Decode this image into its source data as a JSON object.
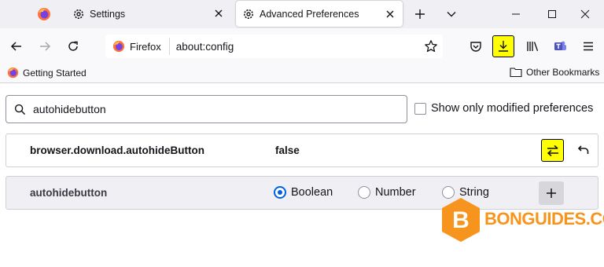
{
  "tabs": [
    {
      "name": "firefox-tab",
      "title": ""
    },
    {
      "name": "settings-tab",
      "title": "Settings"
    },
    {
      "name": "advanced-preferences-tab",
      "title": "Advanced Preferences",
      "active": true
    }
  ],
  "navbar": {
    "identity_label": "Firefox",
    "url": "about:config"
  },
  "bookmarks": {
    "left_item": "Getting Started",
    "right_item": "Other Bookmarks"
  },
  "config": {
    "search_value": "autohidebutton",
    "modified_only_label": "Show only modified preferences",
    "modified_only_checked": false,
    "existing_pref": {
      "name": "browser.download.autohideButton",
      "value": "false"
    },
    "new_pref": {
      "name": "autohidebutton",
      "types": [
        "Boolean",
        "Number",
        "String"
      ],
      "selected": "Boolean"
    }
  },
  "watermark": {
    "text": "BONGUIDES.COM",
    "letter": "B"
  },
  "colors": {
    "highlight": "#ffff00",
    "accent": "#0061e0",
    "watermark": "#f7941d",
    "firefox_orange": "#ff7139",
    "firefox_purple": "#7542e5"
  },
  "icons": [
    "firefox-logo-icon",
    "gear-icon",
    "close-icon",
    "plus-icon",
    "chevron-down-icon",
    "minimize-icon",
    "maximize-icon",
    "back-arrow-icon",
    "forward-arrow-icon",
    "reload-icon",
    "star-icon",
    "pocket-icon",
    "download-icon",
    "library-icon",
    "teams-icon",
    "menu-icon",
    "folder-icon",
    "search-icon",
    "toggle-icon",
    "reset-icon"
  ]
}
